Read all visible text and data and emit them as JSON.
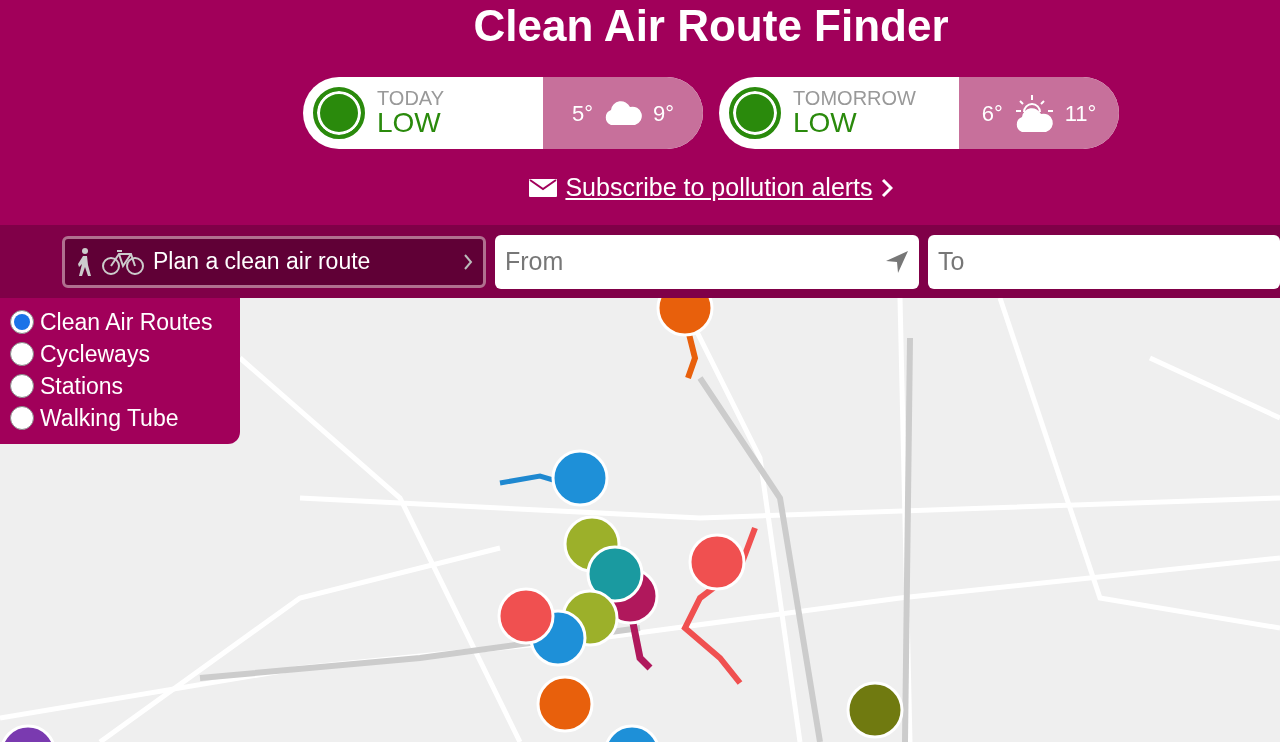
{
  "title": "Clean Air Route Finder",
  "forecasts": [
    {
      "label": "TODAY",
      "level": "LOW",
      "color": "#2a8a0c",
      "low": "5°",
      "high": "9°",
      "kind": "cloud"
    },
    {
      "label": "TOMORROW",
      "level": "LOW",
      "color": "#2a8a0c",
      "low": "6°",
      "high": "11°",
      "kind": "sun-cloud"
    }
  ],
  "subscribe_link": "Subscribe to pollution alerts",
  "plan_button": "Plan a clean air route",
  "from_field": {
    "placeholder": "From"
  },
  "to_field": {
    "placeholder": "To"
  },
  "layers": [
    {
      "label": "Clean Air Routes",
      "selected": true
    },
    {
      "label": "Cycleways",
      "selected": false
    },
    {
      "label": "Stations",
      "selected": false
    },
    {
      "label": "Walking Tube",
      "selected": false
    }
  ]
}
